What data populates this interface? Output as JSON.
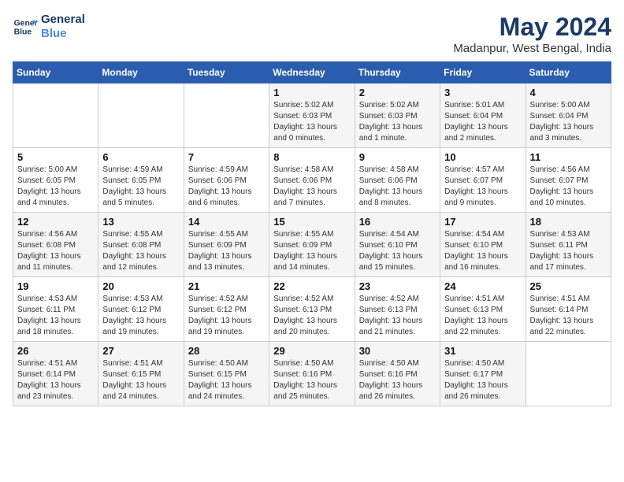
{
  "header": {
    "logo_line1": "General",
    "logo_line2": "Blue",
    "month": "May 2024",
    "location": "Madanpur, West Bengal, India"
  },
  "days_of_week": [
    "Sunday",
    "Monday",
    "Tuesday",
    "Wednesday",
    "Thursday",
    "Friday",
    "Saturday"
  ],
  "weeks": [
    [
      {
        "day": "",
        "info": ""
      },
      {
        "day": "",
        "info": ""
      },
      {
        "day": "",
        "info": ""
      },
      {
        "day": "1",
        "info": "Sunrise: 5:02 AM\nSunset: 6:03 PM\nDaylight: 13 hours\nand 0 minutes."
      },
      {
        "day": "2",
        "info": "Sunrise: 5:02 AM\nSunset: 6:03 PM\nDaylight: 13 hours\nand 1 minute."
      },
      {
        "day": "3",
        "info": "Sunrise: 5:01 AM\nSunset: 6:04 PM\nDaylight: 13 hours\nand 2 minutes."
      },
      {
        "day": "4",
        "info": "Sunrise: 5:00 AM\nSunset: 6:04 PM\nDaylight: 13 hours\nand 3 minutes."
      }
    ],
    [
      {
        "day": "5",
        "info": "Sunrise: 5:00 AM\nSunset: 6:05 PM\nDaylight: 13 hours\nand 4 minutes."
      },
      {
        "day": "6",
        "info": "Sunrise: 4:59 AM\nSunset: 6:05 PM\nDaylight: 13 hours\nand 5 minutes."
      },
      {
        "day": "7",
        "info": "Sunrise: 4:59 AM\nSunset: 6:06 PM\nDaylight: 13 hours\nand 6 minutes."
      },
      {
        "day": "8",
        "info": "Sunrise: 4:58 AM\nSunset: 6:06 PM\nDaylight: 13 hours\nand 7 minutes."
      },
      {
        "day": "9",
        "info": "Sunrise: 4:58 AM\nSunset: 6:06 PM\nDaylight: 13 hours\nand 8 minutes."
      },
      {
        "day": "10",
        "info": "Sunrise: 4:57 AM\nSunset: 6:07 PM\nDaylight: 13 hours\nand 9 minutes."
      },
      {
        "day": "11",
        "info": "Sunrise: 4:56 AM\nSunset: 6:07 PM\nDaylight: 13 hours\nand 10 minutes."
      }
    ],
    [
      {
        "day": "12",
        "info": "Sunrise: 4:56 AM\nSunset: 6:08 PM\nDaylight: 13 hours\nand 11 minutes."
      },
      {
        "day": "13",
        "info": "Sunrise: 4:55 AM\nSunset: 6:08 PM\nDaylight: 13 hours\nand 12 minutes."
      },
      {
        "day": "14",
        "info": "Sunrise: 4:55 AM\nSunset: 6:09 PM\nDaylight: 13 hours\nand 13 minutes."
      },
      {
        "day": "15",
        "info": "Sunrise: 4:55 AM\nSunset: 6:09 PM\nDaylight: 13 hours\nand 14 minutes."
      },
      {
        "day": "16",
        "info": "Sunrise: 4:54 AM\nSunset: 6:10 PM\nDaylight: 13 hours\nand 15 minutes."
      },
      {
        "day": "17",
        "info": "Sunrise: 4:54 AM\nSunset: 6:10 PM\nDaylight: 13 hours\nand 16 minutes."
      },
      {
        "day": "18",
        "info": "Sunrise: 4:53 AM\nSunset: 6:11 PM\nDaylight: 13 hours\nand 17 minutes."
      }
    ],
    [
      {
        "day": "19",
        "info": "Sunrise: 4:53 AM\nSunset: 6:11 PM\nDaylight: 13 hours\nand 18 minutes."
      },
      {
        "day": "20",
        "info": "Sunrise: 4:53 AM\nSunset: 6:12 PM\nDaylight: 13 hours\nand 19 minutes."
      },
      {
        "day": "21",
        "info": "Sunrise: 4:52 AM\nSunset: 6:12 PM\nDaylight: 13 hours\nand 19 minutes."
      },
      {
        "day": "22",
        "info": "Sunrise: 4:52 AM\nSunset: 6:13 PM\nDaylight: 13 hours\nand 20 minutes."
      },
      {
        "day": "23",
        "info": "Sunrise: 4:52 AM\nSunset: 6:13 PM\nDaylight: 13 hours\nand 21 minutes."
      },
      {
        "day": "24",
        "info": "Sunrise: 4:51 AM\nSunset: 6:13 PM\nDaylight: 13 hours\nand 22 minutes."
      },
      {
        "day": "25",
        "info": "Sunrise: 4:51 AM\nSunset: 6:14 PM\nDaylight: 13 hours\nand 22 minutes."
      }
    ],
    [
      {
        "day": "26",
        "info": "Sunrise: 4:51 AM\nSunset: 6:14 PM\nDaylight: 13 hours\nand 23 minutes."
      },
      {
        "day": "27",
        "info": "Sunrise: 4:51 AM\nSunset: 6:15 PM\nDaylight: 13 hours\nand 24 minutes."
      },
      {
        "day": "28",
        "info": "Sunrise: 4:50 AM\nSunset: 6:15 PM\nDaylight: 13 hours\nand 24 minutes."
      },
      {
        "day": "29",
        "info": "Sunrise: 4:50 AM\nSunset: 6:16 PM\nDaylight: 13 hours\nand 25 minutes."
      },
      {
        "day": "30",
        "info": "Sunrise: 4:50 AM\nSunset: 6:16 PM\nDaylight: 13 hours\nand 26 minutes."
      },
      {
        "day": "31",
        "info": "Sunrise: 4:50 AM\nSunset: 6:17 PM\nDaylight: 13 hours\nand 26 minutes."
      },
      {
        "day": "",
        "info": ""
      }
    ]
  ]
}
